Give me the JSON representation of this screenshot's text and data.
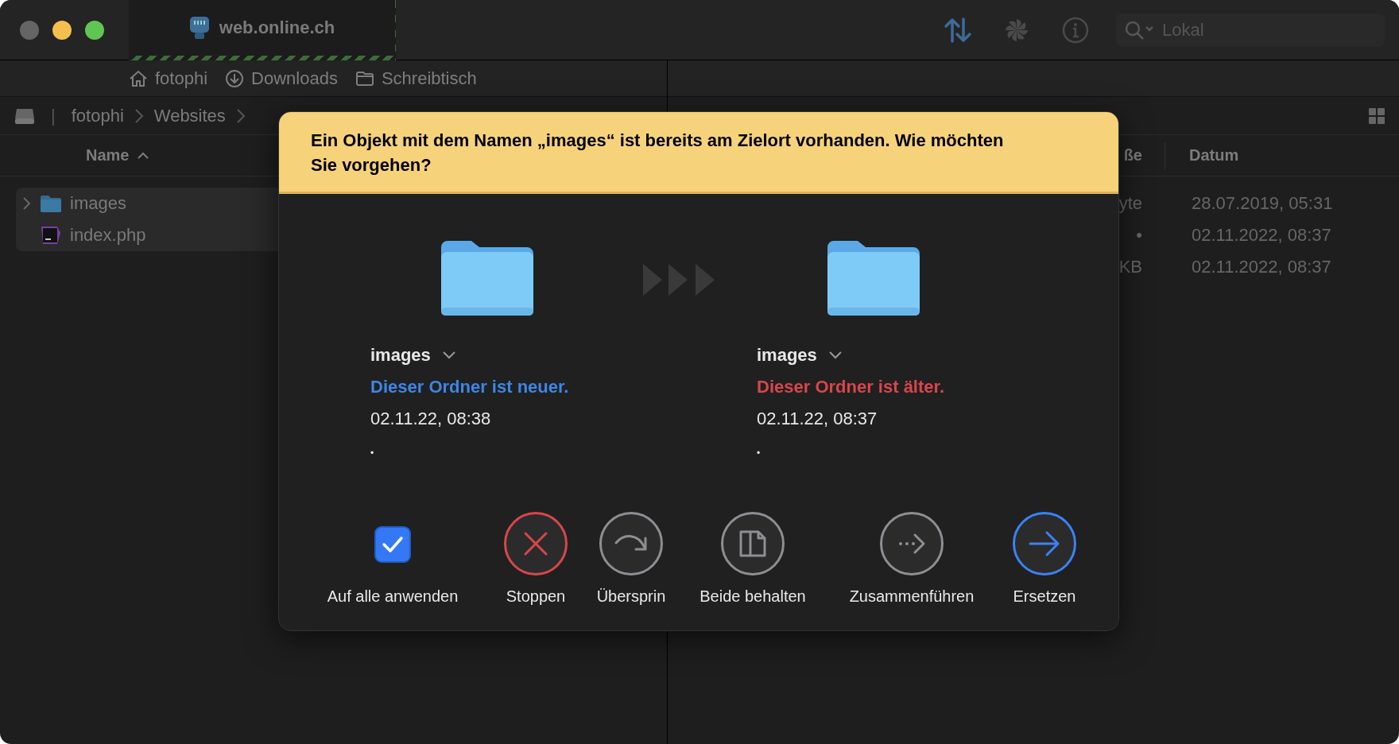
{
  "window": {
    "tab_title": "web.online.ch",
    "search": {
      "placeholder": "Lokal"
    }
  },
  "favorites": [
    {
      "label": "fotophi",
      "kind": "home"
    },
    {
      "label": "Downloads",
      "kind": "download"
    },
    {
      "label": "Schreibtisch",
      "kind": "folder"
    }
  ],
  "left_pane": {
    "separator": "|",
    "breadcrumb": [
      "fotophi",
      "Websites"
    ],
    "column": "Name",
    "rows": [
      {
        "name": "images",
        "kind": "folder",
        "selected": true
      },
      {
        "name": "index.php",
        "kind": "php",
        "selected": true
      }
    ]
  },
  "right_pane": {
    "columns": [
      "ße",
      "Datum"
    ],
    "rows": [
      {
        "size": "yte",
        "date": "28.07.2019, 05:31"
      },
      {
        "size": "•",
        "date": "02.11.2022, 08:37"
      },
      {
        "size": "KB",
        "date": "02.11.2022, 08:37"
      }
    ]
  },
  "dialog": {
    "message": "Ein Objekt mit dem Namen „images“ ist bereits am Zielort vorhanden. Wie möchten Sie vorgehen?",
    "items": [
      {
        "name": "images",
        "status": "Dieser Ordner ist neuer.",
        "kind": "newer",
        "date": "02.11.22, 08:38",
        "size": "•"
      },
      {
        "name": "images",
        "status": "Dieser Ordner ist älter.",
        "kind": "older",
        "date": "02.11.22, 08:37",
        "size": "•"
      }
    ],
    "actions": [
      {
        "label": "Auf alle anwenden",
        "kind": "checkbox",
        "checked": true
      },
      {
        "label": "Stoppen",
        "kind": "stop"
      },
      {
        "label": "Übersprin",
        "kind": "skip"
      },
      {
        "label": "Beide behalten",
        "kind": "keep-both"
      },
      {
        "label": "Zusammenführen",
        "kind": "merge"
      },
      {
        "label": "Ersetzen",
        "kind": "replace"
      }
    ]
  }
}
